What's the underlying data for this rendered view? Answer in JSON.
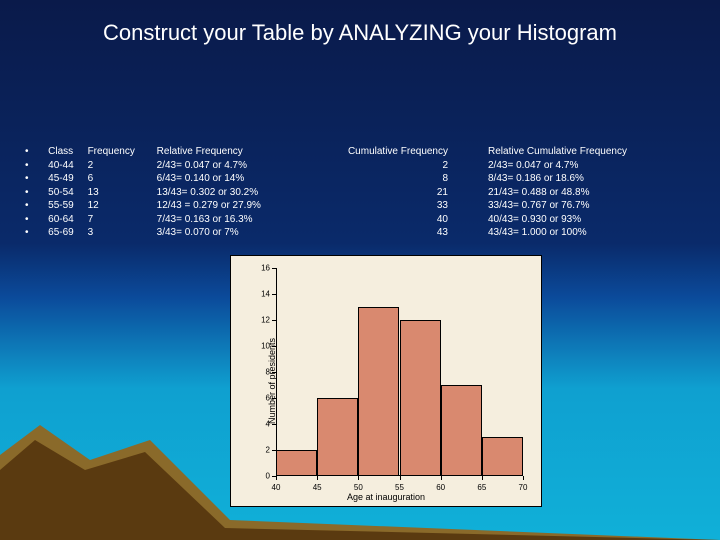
{
  "title": "Construct your Table by ANALYZING your Histogram",
  "headers": {
    "class": "Class",
    "freq": "Frequency",
    "rel": "Relative Frequency",
    "cum": "Cumulative Frequency",
    "rcum": "Relative Cumulative Frequency"
  },
  "rows": [
    {
      "class": "40-44",
      "freq": "2",
      "rel": "2/43= 0.047 or 4.7%",
      "cum": "2",
      "rcum": "2/43= 0.047 or 4.7%"
    },
    {
      "class": "45-49",
      "freq": "6",
      "rel": "6/43= 0.140 or 14%",
      "cum": "8",
      "rcum": "8/43= 0.186 or 18.6%"
    },
    {
      "class": "50-54",
      "freq": "13",
      "rel": "13/43= 0.302 or 30.2%",
      "cum": "21",
      "rcum": "21/43= 0.488 or 48.8%"
    },
    {
      "class": "55-59",
      "freq": "12",
      "rel": "12/43 = 0.279 or 27.9%",
      "cum": "33",
      "rcum": "33/43= 0.767 or 76.7%"
    },
    {
      "class": "60-64",
      "freq": "7",
      "rel": "7/43= 0.163 or 16.3%",
      "cum": "40",
      "rcum": "40/43= 0.930 or 93%"
    },
    {
      "class": "65-69",
      "freq": "3",
      "rel": "3/43= 0.070 or 7%",
      "cum": "43",
      "rcum": "43/43= 1.000 or 100%"
    }
  ],
  "chart_data": {
    "type": "bar",
    "title": "",
    "xlabel": "Age at inauguration",
    "ylabel": "Number of presidents",
    "xlim": [
      40,
      70
    ],
    "ylim": [
      0,
      16
    ],
    "xticks": [
      40,
      45,
      50,
      55,
      60,
      65,
      70
    ],
    "yticks": [
      0,
      2,
      4,
      6,
      8,
      10,
      12,
      14,
      16
    ],
    "categories": [
      "40-44",
      "45-49",
      "50-54",
      "55-59",
      "60-64",
      "65-69"
    ],
    "bin_edges": [
      40,
      45,
      50,
      55,
      60,
      65,
      70
    ],
    "values": [
      2,
      6,
      13,
      12,
      7,
      3
    ]
  }
}
